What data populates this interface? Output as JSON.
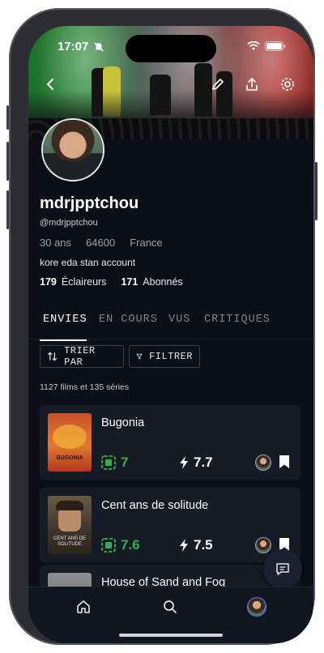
{
  "status_bar": {
    "time": "17:07"
  },
  "banner": {
    "icons": [
      "back-chevron-icon",
      "edit-pencil-icon",
      "share-icon",
      "settings-gear-icon"
    ]
  },
  "profile": {
    "username": "mdrjpptchou",
    "handle": "@mdrjpptchou",
    "age": "30 ans",
    "postal_code": "64600",
    "country": "France",
    "bio": "kore eda stan account",
    "eclaireurs_count": "179",
    "eclaireurs_label": "Éclaireurs",
    "abonnes_count": "171",
    "abonnes_label": "Abonnés"
  },
  "tabs": [
    {
      "label": "ENVIES",
      "active": true
    },
    {
      "label": "EN COURS",
      "active": false
    },
    {
      "label": "VUS",
      "active": false
    },
    {
      "label": "CRITIQUES",
      "active": false
    }
  ],
  "actions": {
    "sort_label": "TRIER PAR",
    "filter_label": "FILTRER"
  },
  "list_count": "1127 films et 135 séries",
  "items": [
    {
      "title": "Bugonia",
      "score": "7",
      "rating": "7.7",
      "poster_text": "BUGONIA"
    },
    {
      "title": "Cent ans de solitude",
      "score": "7.6",
      "rating": "7.5",
      "poster_text": "CENT ANS DE SOLITUDE"
    },
    {
      "title": "House of Sand and Fog",
      "score": "",
      "rating": ""
    }
  ],
  "colors": {
    "accent_green": "#2fb24d",
    "background": "#0c0f17",
    "card": "#161b25"
  }
}
